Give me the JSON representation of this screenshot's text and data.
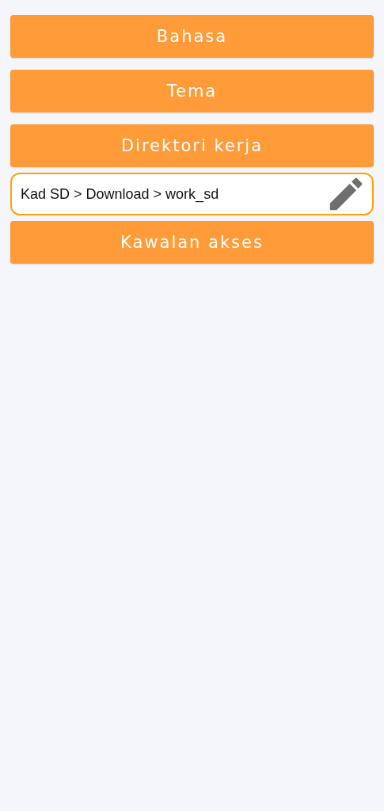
{
  "items": [
    {
      "kind": "button",
      "label": "Bahasa"
    },
    {
      "kind": "button",
      "label": "Tema"
    },
    {
      "kind": "button",
      "label": "Direktori kerja"
    },
    {
      "kind": "path",
      "value": "Kad SD > Download > work_sd"
    },
    {
      "kind": "button",
      "label": "Kawalan akses"
    }
  ]
}
